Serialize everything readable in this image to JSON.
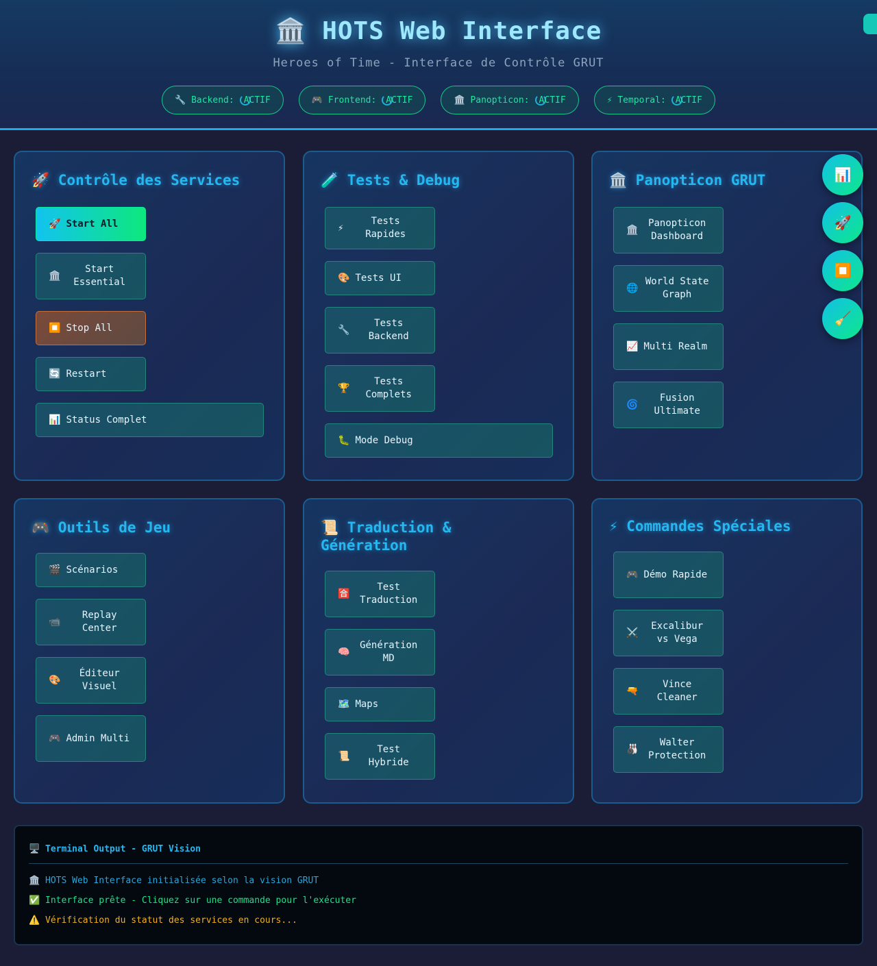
{
  "header": {
    "title": "🏛️ HOTS Web Interface",
    "subtitle": "Heroes of Time - Interface de Contrôle GRUT",
    "services": [
      {
        "label": "🔧 Backend:",
        "status": "ACTIF"
      },
      {
        "label": "🎮 Frontend:",
        "status": "ACTIF"
      },
      {
        "label": "🏛️ Panopticon:",
        "status": "ACTIF"
      },
      {
        "label": "⚡ Temporal:",
        "status": "ACTIF"
      }
    ]
  },
  "panels": {
    "services": {
      "title": "🚀 Contrôle des Services",
      "buttons": [
        {
          "icon": "🚀",
          "label": "Start All"
        },
        {
          "icon": "🏛️",
          "label": "Start Essential"
        },
        {
          "icon": "⏹️",
          "label": "Stop All"
        },
        {
          "icon": "🔄",
          "label": "Restart"
        },
        {
          "icon": "📊",
          "label": "Status Complet"
        }
      ]
    },
    "tests": {
      "title": "🧪 Tests & Debug",
      "buttons": [
        {
          "icon": "⚡",
          "label": "Tests Rapides"
        },
        {
          "icon": "🎨",
          "label": "Tests UI"
        },
        {
          "icon": "🔧",
          "label": "Tests Backend"
        },
        {
          "icon": "🏆",
          "label": "Tests Complets"
        },
        {
          "icon": "🐛",
          "label": "Mode Debug"
        }
      ]
    },
    "panopticon": {
      "title": "🏛️ Panopticon GRUT",
      "buttons": [
        {
          "icon": "🏛️",
          "label": "Panopticon Dashboard"
        },
        {
          "icon": "🌐",
          "label": "World State Graph"
        },
        {
          "icon": "📈",
          "label": "Multi Realm"
        },
        {
          "icon": "🌀",
          "label": "Fusion Ultimate"
        }
      ]
    },
    "game": {
      "title": "🎮 Outils de Jeu",
      "buttons": [
        {
          "icon": "🎬",
          "label": "Scénarios"
        },
        {
          "icon": "📹",
          "label": "Replay Center"
        },
        {
          "icon": "🎨",
          "label": "Éditeur Visuel"
        },
        {
          "icon": "🎮",
          "label": "Admin Multi"
        }
      ]
    },
    "translation": {
      "title": "📜 Traduction & Génération",
      "buttons": [
        {
          "icon": "🈴",
          "label": "Test Traduction"
        },
        {
          "icon": "🧠",
          "label": "Génération MD"
        },
        {
          "icon": "🗺️",
          "label": "Maps"
        },
        {
          "icon": "📜",
          "label": "Test Hybride"
        }
      ]
    },
    "special": {
      "title": "⚡ Commandes Spéciales",
      "buttons": [
        {
          "icon": "🎮",
          "label": "Démo Rapide"
        },
        {
          "icon": "⚔️",
          "label": "Excalibur vs Vega"
        },
        {
          "icon": "🔫",
          "label": "Vince Cleaner"
        },
        {
          "icon": "🎳",
          "label": "Walter Protection"
        }
      ]
    }
  },
  "fabs": [
    {
      "icon": "📊",
      "name": "status-fab"
    },
    {
      "icon": "🚀",
      "name": "start-fab"
    },
    {
      "icon": "⏹️",
      "name": "stop-fab"
    },
    {
      "icon": "🧹",
      "name": "clean-fab"
    }
  ],
  "terminal": {
    "title": "🖥️ Terminal Output - GRUT Vision",
    "lines": [
      {
        "icon": "🏛️",
        "text": "HOTS Web Interface initialisée selon la vision GRUT",
        "color": "#2aa6d8"
      },
      {
        "icon": "✅",
        "text": "Interface prête - Cliquez sur une commande pour l'exécuter",
        "color": "#1fe08a"
      },
      {
        "icon": "⚠️",
        "text": "Vérification du statut des services en cours...",
        "color": "#f0b020"
      }
    ]
  }
}
